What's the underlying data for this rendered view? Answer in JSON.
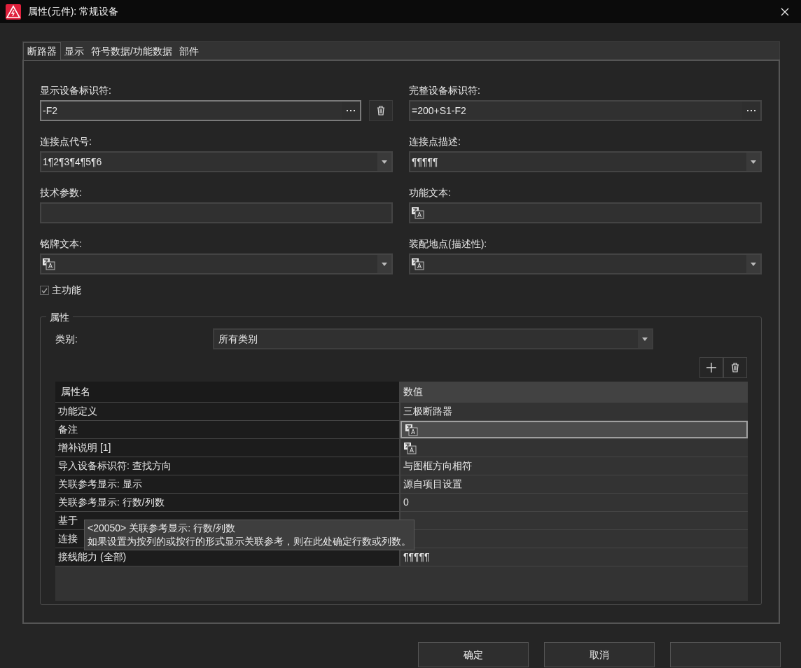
{
  "window": {
    "title": "属性(元件): 常规设备"
  },
  "tabs": [
    {
      "label": "断路器",
      "selected": true
    },
    {
      "label": "显示",
      "selected": false
    },
    {
      "label": "符号数据/功能数据",
      "selected": false
    },
    {
      "label": "部件",
      "selected": false
    }
  ],
  "fields": [
    {
      "label": "显示设备标识符:",
      "kind": "text",
      "value": "-F2",
      "browse": true,
      "delete": true,
      "focused": true
    },
    {
      "label": "完整设备标识符:",
      "kind": "text",
      "value": "=200+S1-F2",
      "browse": true
    },
    {
      "label": "连接点代号:",
      "kind": "dropdown",
      "value": "1¶2¶3¶4¶5¶6"
    },
    {
      "label": "连接点描述:",
      "kind": "dropdown",
      "value": "¶¶¶¶¶"
    },
    {
      "label": "技术参数:",
      "kind": "text"
    },
    {
      "label": "功能文本:",
      "kind": "text",
      "multilang": true
    },
    {
      "label": "铭牌文本:",
      "kind": "dropdown",
      "multilang": true
    },
    {
      "label": "装配地点(描述性):",
      "kind": "dropdown",
      "multilang": true
    }
  ],
  "main_function": {
    "label": "主功能",
    "checked": true
  },
  "properties": {
    "title": "属性",
    "category_label": "类别:",
    "category_value": "所有类别",
    "columns": [
      "属性名",
      "数值"
    ],
    "rows": [
      {
        "name": "功能定义",
        "value": "三极断路器",
        "selected": false
      },
      {
        "name": "备注",
        "selected": true,
        "multilang": true
      },
      {
        "name": "增补说明 [1]",
        "selected": false,
        "multilang": true
      },
      {
        "name": "导入设备标识符: 查找方向",
        "value": "与图框方向相符",
        "selected": false
      },
      {
        "name": "关联参考显示: 显示",
        "value": "源自项目设置",
        "selected": false
      },
      {
        "name": "关联参考显示: 行数/列数",
        "value": "0",
        "selected": false
      },
      {
        "name": "基于",
        "selected": false
      },
      {
        "name": "连接",
        "selected": false
      },
      {
        "name": "接线能力 (全部)",
        "value": "¶¶¶¶¶",
        "selected": false
      }
    ],
    "tooltip": {
      "title": "<20050> 关联参考显示: 行数/列数",
      "text": "如果设置为按列的或按行的形式显示关联参考，则在此处确定行数或列数。"
    }
  },
  "buttons": [
    {
      "kind": "text",
      "label": "确定"
    },
    {
      "kind": "text",
      "label": "取消"
    },
    {
      "kind": "blank"
    }
  ]
}
